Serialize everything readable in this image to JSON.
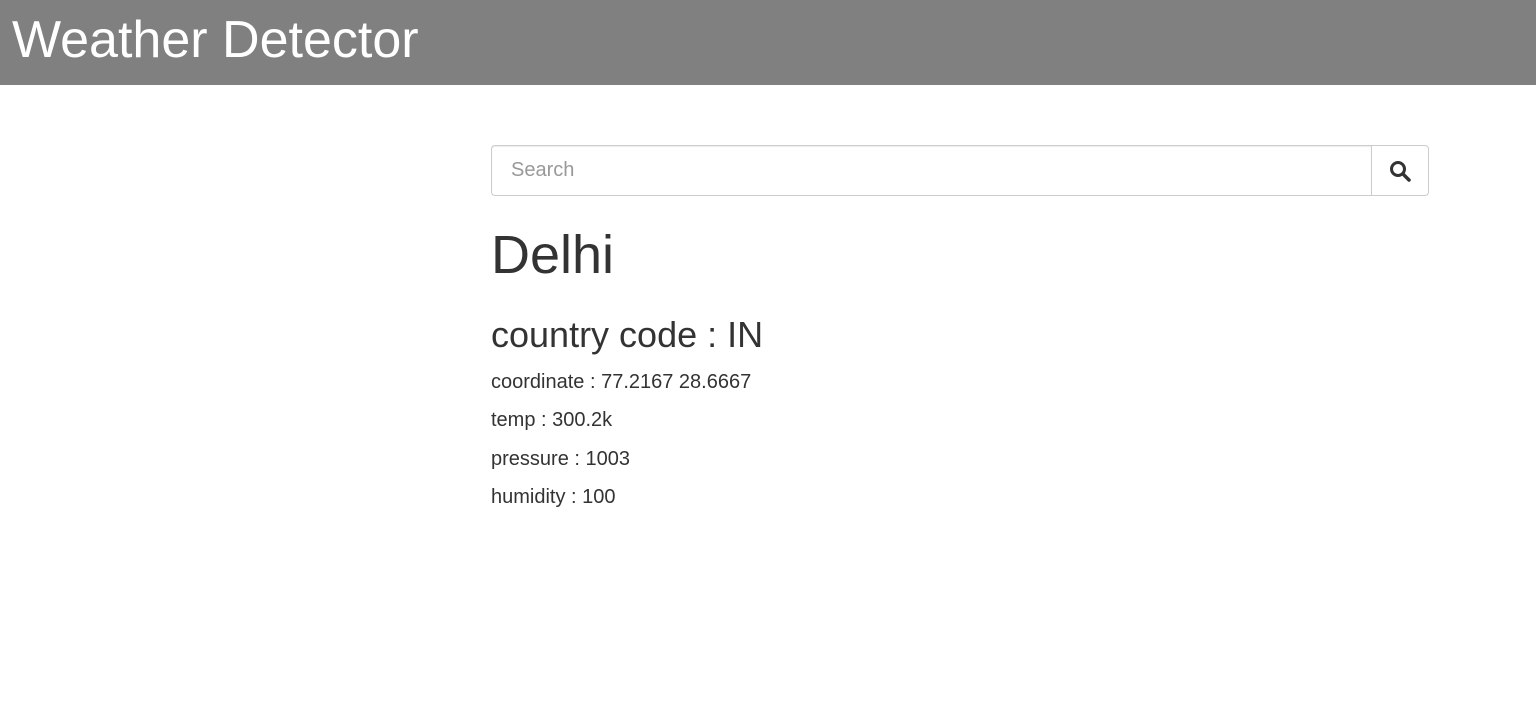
{
  "header": {
    "title": "Weather Detector",
    "background_color": "#808080"
  },
  "search": {
    "placeholder": "Search",
    "value": "",
    "button_icon": "search-icon"
  },
  "weather": {
    "city": "Delhi",
    "country_code": "country code : IN",
    "coordinate": "coordinate : 77.2167 28.6667",
    "temp": "temp : 300.2k",
    "pressure": "pressure : 1003",
    "humidity": "humidity : 100"
  }
}
